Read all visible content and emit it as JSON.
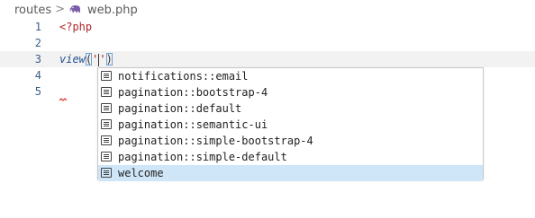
{
  "breadcrumb": {
    "folder": "routes",
    "separator": ">",
    "file": "web.php",
    "file_icon": "php-elephant-icon"
  },
  "editor": {
    "lines": [
      {
        "number": "1",
        "text": "<?php"
      },
      {
        "number": "2",
        "text": ""
      },
      {
        "number": "3",
        "function": "view",
        "open_paren": "(",
        "quote_open": "'",
        "quote_close": "'",
        "close_paren": ")"
      },
      {
        "number": "4",
        "text": ""
      },
      {
        "number": "5",
        "text": ""
      }
    ]
  },
  "suggestions": {
    "icon": "text-document-icon",
    "items": [
      {
        "label": "notifications::email",
        "selected": false
      },
      {
        "label": "pagination::bootstrap-4",
        "selected": false
      },
      {
        "label": "pagination::default",
        "selected": false
      },
      {
        "label": "pagination::semantic-ui",
        "selected": false
      },
      {
        "label": "pagination::simple-bootstrap-4",
        "selected": false
      },
      {
        "label": "pagination::simple-default",
        "selected": false
      },
      {
        "label": "welcome",
        "selected": true
      }
    ]
  },
  "colors": {
    "current_line": "#f2f2f2",
    "selected_suggestion": "#cfe6f8",
    "line_number": "#3a5d87",
    "php_tag": "#b1272b",
    "function_name": "#1f4e8c"
  }
}
